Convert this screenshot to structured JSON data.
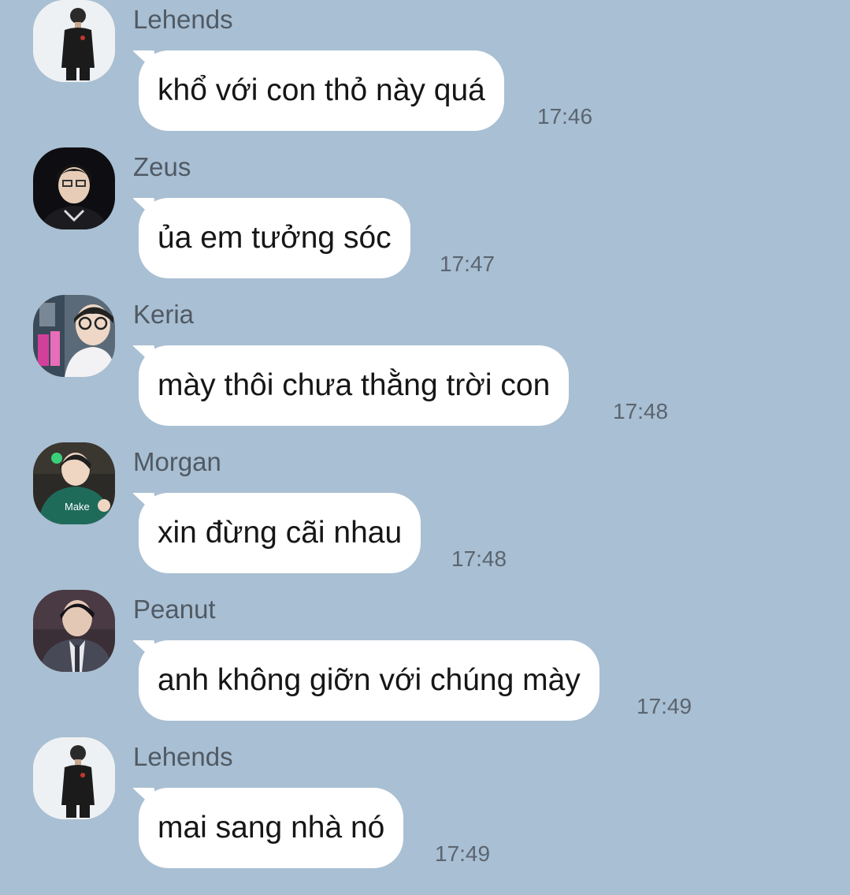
{
  "messages": [
    {
      "sender": "Lehends",
      "text": "khổ với con thỏ này quá",
      "time": "17:46",
      "avatar": "lehends-avatar"
    },
    {
      "sender": "Zeus",
      "text": "ủa em tưởng sóc",
      "time": "17:47",
      "avatar": "zeus-avatar"
    },
    {
      "sender": "Keria",
      "text": "mày thôi chưa thằng trời con",
      "time": "17:48",
      "avatar": "keria-avatar"
    },
    {
      "sender": "Morgan",
      "text": "xin đừng cãi nhau",
      "time": "17:48",
      "avatar": "morgan-avatar"
    },
    {
      "sender": "Peanut",
      "text": "anh không giỡn với chúng mày",
      "time": "17:49",
      "avatar": "peanut-avatar"
    },
    {
      "sender": "Lehends",
      "text": "mai sang nhà nó",
      "time": "17:49",
      "avatar": "lehends-avatar"
    }
  ],
  "colors": {
    "background": "#a9bfd3",
    "bubble": "#ffffff",
    "sender_name": "#505a64",
    "timestamp": "#5b6570"
  }
}
